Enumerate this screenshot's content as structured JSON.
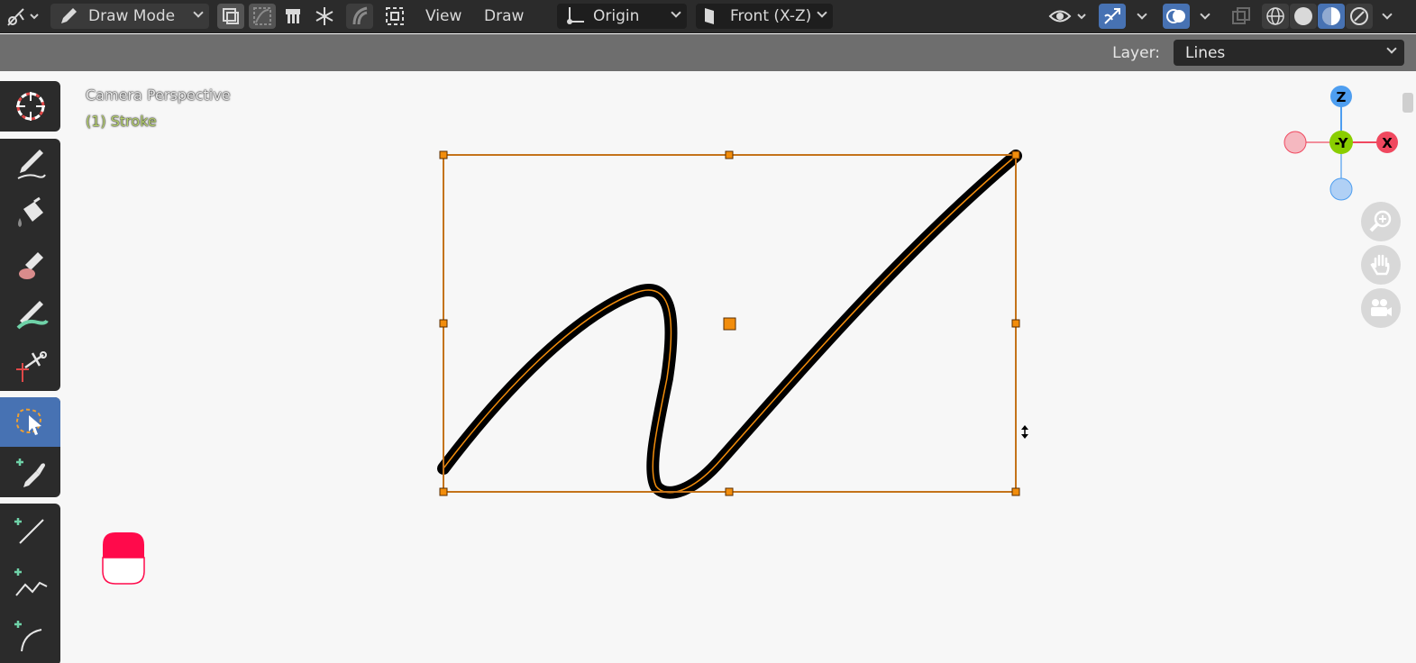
{
  "header": {
    "mode_label": "Draw Mode",
    "menu_view": "View",
    "menu_draw": "Draw",
    "origin_label": "Origin",
    "view_label": "Front (X-Z)"
  },
  "subheader": {
    "layer_label": "Layer:",
    "layer_value": "Lines"
  },
  "viewport": {
    "camera_text": "Camera Perspective",
    "object_text": "(1) Stroke"
  },
  "gizmo": {
    "z_label": "Z",
    "y_label": "-Y",
    "x_label": "X"
  },
  "colors": {
    "header_bg": "#2b2b2b",
    "subheader_bg": "#6e6e6e",
    "viewport_bg": "#f7f7f7",
    "accent_blue": "#4772b3",
    "selection_orange": "#f28d0c",
    "object_text_green": "#b5cf6d",
    "material_red": "#ff0a4b",
    "axis_x": "#f0485f",
    "axis_y": "#8ace00",
    "axis_z": "#4e9ef0"
  },
  "icons": {
    "toolbar": [
      "cursor-icon",
      "draw-icon",
      "fill-icon",
      "erase-icon",
      "tint-icon",
      "cutter-icon",
      "select-box-icon",
      "eyedropper-icon",
      "line-icon",
      "polyline-icon",
      "arc-icon"
    ],
    "navigation": [
      "zoom-icon",
      "pan-icon",
      "camera-icon"
    ]
  }
}
